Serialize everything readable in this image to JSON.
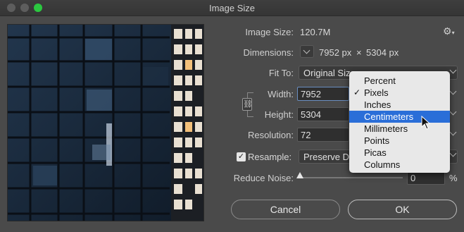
{
  "window": {
    "title": "Image Size"
  },
  "image_size": {
    "label": "Image Size:",
    "value": "120.7M"
  },
  "dimensions": {
    "label": "Dimensions:",
    "width": "7952 px",
    "sep": "×",
    "height": "5304 px"
  },
  "fit_to": {
    "label": "Fit To:",
    "value": "Original Size"
  },
  "width": {
    "label": "Width:",
    "value": "7952"
  },
  "height": {
    "label": "Height:",
    "value": "5304"
  },
  "resolution": {
    "label": "Resolution:",
    "value": "72"
  },
  "resample": {
    "label": "Resample:",
    "checked": true,
    "value": "Preserve De"
  },
  "reduce_noise": {
    "label": "Reduce Noise:",
    "value": "0",
    "unit": "%"
  },
  "units_menu": {
    "items": [
      "Percent",
      "Pixels",
      "Inches",
      "Centimeters",
      "Millimeters",
      "Points",
      "Picas",
      "Columns"
    ],
    "checked": "Pixels",
    "highlighted": "Centimeters"
  },
  "buttons": {
    "cancel": "Cancel",
    "ok": "OK"
  },
  "colors": {
    "accent": "#2a6ed8",
    "window_bg": "#4a4a4a"
  }
}
